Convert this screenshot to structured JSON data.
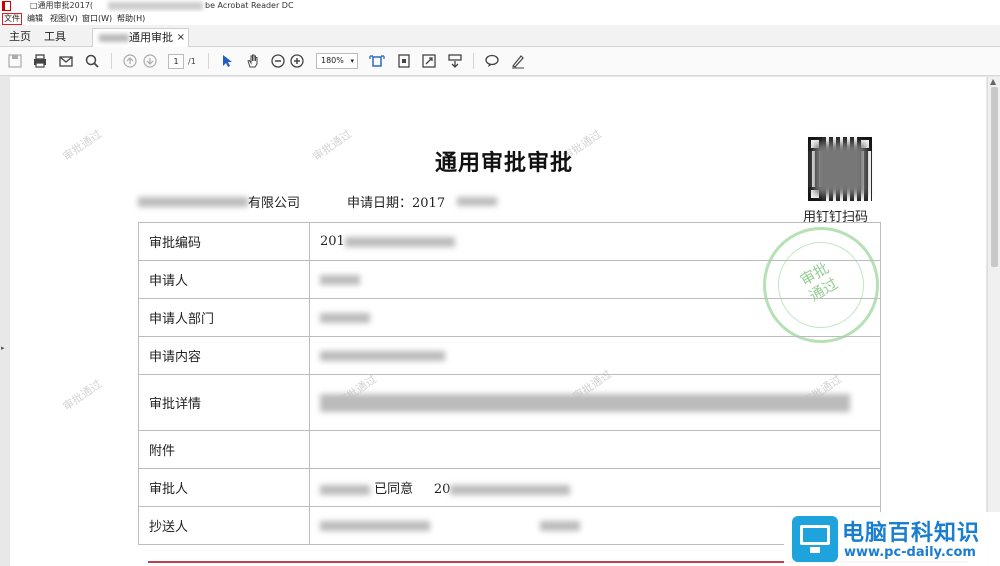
{
  "titlebar": {
    "prefix": "□通用审批2017(",
    "suffix": "be Acrobat Reader DC"
  },
  "menu": [
    "文件",
    "编辑",
    "视图(V)",
    "窗口(W)",
    "帮助(H)"
  ],
  "tabs": {
    "home": "主页",
    "tools": "工具",
    "doc": "通用审批2...",
    "close": "×"
  },
  "toolbar": {
    "page_current": "1",
    "page_total": "/1",
    "zoom": "180%",
    "zoom_arrow": "▾"
  },
  "document": {
    "title": "通用审批审批",
    "company_suffix": "有限公司",
    "apply_date_label": "申请日期：2017",
    "qr_label": "用钉钉扫码",
    "stamp_line1": "审批",
    "stamp_line2": "通过",
    "watermark": "审批通过",
    "rows": [
      {
        "label": "审批编码",
        "value": "201"
      },
      {
        "label": "申请人",
        "value": ""
      },
      {
        "label": "申请人部门",
        "value": ""
      },
      {
        "label": "申请内容",
        "value": ""
      },
      {
        "label": "审批详情",
        "value": ""
      },
      {
        "label": "附件",
        "value": ""
      },
      {
        "label": "审批人",
        "value": "已同意",
        "date": "20"
      },
      {
        "label": "抄送人",
        "value": ""
      }
    ]
  },
  "logo": {
    "name": "电脑百科知识",
    "url": "www.pc-daily.com"
  },
  "colors": {
    "highlight": "#e02020",
    "logo_blue": "#1a7ed0",
    "stamp_green": "#5ab45a"
  }
}
